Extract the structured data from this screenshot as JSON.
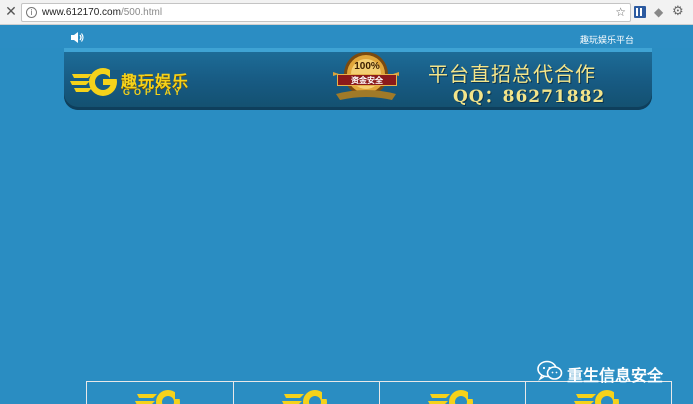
{
  "browser": {
    "url_host": "www.612170.com",
    "url_path": "/500.html",
    "close_icon": "close-icon",
    "info_icon": "info-icon",
    "bookmark_icon": "star-icon",
    "extension_icons": [
      "grid-extension-icon",
      "shield-extension-icon",
      "gear-extension-icon"
    ]
  },
  "site": {
    "top_link": "趣玩娱乐平台",
    "sound_icon": "speaker-icon",
    "logo_cn": "趣玩娱乐",
    "logo_en": "GOPLAY",
    "badge": {
      "percent": "100%",
      "label": "资金安全"
    },
    "slogan": "平台直招总代合作",
    "qq": "QQ：86271882"
  },
  "game_cards": [
    {
      "icon": "goplay-g-logo-icon"
    },
    {
      "icon": "goplay-g-logo-icon"
    },
    {
      "icon": "goplay-g-logo-icon"
    },
    {
      "icon": "goplay-g-logo-icon"
    }
  ],
  "watermark": {
    "text": "重生信息安全",
    "icon": "wechat-icon"
  },
  "colors": {
    "page_background": "#2a8dc2",
    "banner_dark": "#175a82",
    "logo_yellow": "#f5d21a",
    "slogan_gold": "#f4e58a",
    "badge_red": "#8b1a1a"
  }
}
